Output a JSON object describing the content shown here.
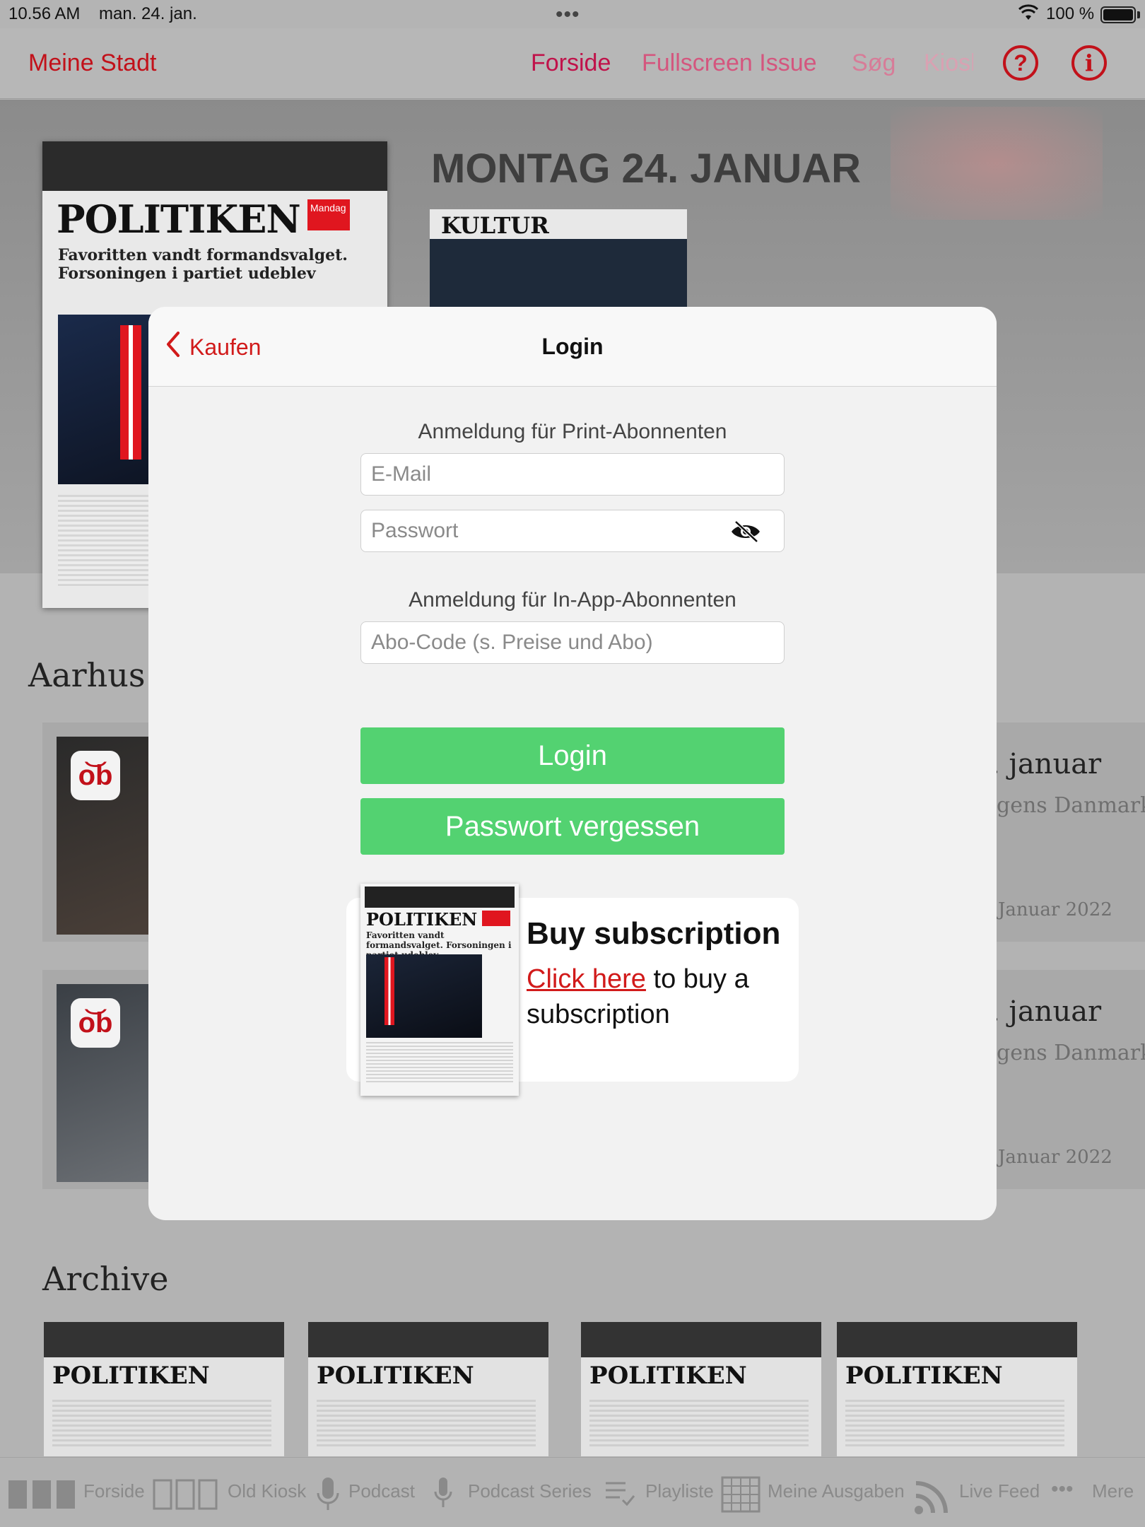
{
  "status_bar": {
    "time": "10.56 AM",
    "date": "man. 24. jan.",
    "dots": "•••",
    "battery": "100 %"
  },
  "nav": {
    "left": "Meine Stadt",
    "tabs": [
      {
        "label": "Forside"
      },
      {
        "label": "Fullscreen Issue"
      },
      {
        "label": "Søg"
      },
      {
        "label": "Kiosk"
      }
    ],
    "help_icon": "?",
    "info_icon": "i"
  },
  "hero": {
    "date_title": "MONTAG 24. JANUAR",
    "cover_masthead": "POLITIKEN",
    "cover_tag": "Mandag",
    "cover_headline": "Favoritten vandt formandsvalget. Forsoningen i partiet udeblev",
    "kultur_label": "KULTUR"
  },
  "sections": {
    "aarhus": "Aarhus",
    "archive": "Archive",
    "cards": [
      {
        "title": ". januar",
        "subtitle": "gens Danmark",
        "date": "Januar 2022"
      },
      {
        "title": ". januar",
        "subtitle": "gens Danmark",
        "date": "Januar 2022"
      }
    ],
    "archive_masthead": "POLITIKEN"
  },
  "tabbar": [
    {
      "label": "Forside",
      "icon": "forside-icon"
    },
    {
      "label": "Old Kiosk",
      "icon": "old-kiosk-icon"
    },
    {
      "label": "Podcast",
      "icon": "microphone-icon"
    },
    {
      "label": "Podcast Series",
      "icon": "microphone-icon"
    },
    {
      "label": "Playliste",
      "icon": "playlist-icon"
    },
    {
      "label": "Meine Ausgaben",
      "icon": "calendar-grid-icon"
    },
    {
      "label": "Live Feed",
      "icon": "rss-icon"
    },
    {
      "label": "Mere",
      "icon": "more-icon"
    }
  ],
  "modal": {
    "back_label": "Kaufen",
    "title": "Login",
    "print_label": "Anmeldung für Print-Abonnenten",
    "email_placeholder": "E-Mail",
    "password_placeholder": "Passwort",
    "inapp_label": "Anmeldung für In-App-Abonnenten",
    "abo_placeholder": "Abo-Code (s. Preise und Abo)",
    "login_button": "Login",
    "forgot_button": "Passwort vergessen",
    "promo": {
      "title": "Buy subscription",
      "link": "Click here",
      "text_after_link": " to buy a subscription",
      "cover_masthead": "POLITIKEN",
      "cover_headline": "Favoritten vandt formandsvalget. Forsoningen i partiet udeblev"
    }
  },
  "colors": {
    "accent_red": "#d11a1a",
    "nav_pink": "#c0124a",
    "green": "#53d271"
  }
}
